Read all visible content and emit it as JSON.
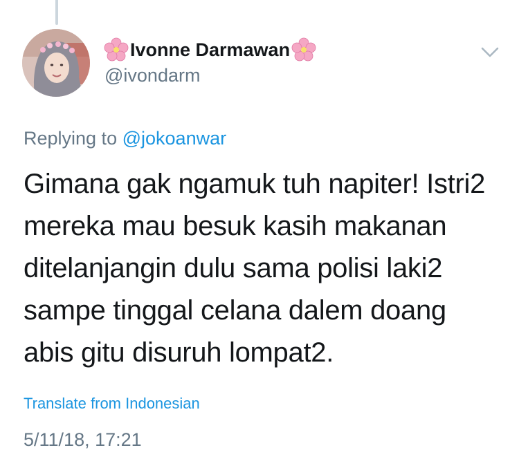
{
  "tweet": {
    "author": {
      "display_name": "Ivonne Darmawan",
      "name_decoration_icon": "cherry-blossom-icon",
      "handle": "@ivondarm",
      "avatar_icon": "profile-photo"
    },
    "menu_icon": "chevron-down-icon",
    "reply_prefix": "Replying to",
    "reply_handle": "@jokoanwar",
    "text_lines": [
      "Gimana gak ngamuk tuh napiter! Istri2",
      "mereka mau besuk kasih makanan",
      "ditelanjangin dulu sama polisi laki2",
      "sampe tinggal celana dalem doang",
      "abis gitu disuruh lompat2."
    ],
    "translate_label": "Translate from Indonesian",
    "timestamp": "5/11/18, 17:21"
  },
  "colors": {
    "text_primary": "#14171a",
    "text_secondary": "#657786",
    "link": "#1b95e0",
    "thread_line": "#ccd6dd",
    "blossom_pink": "#f5a7c4"
  }
}
